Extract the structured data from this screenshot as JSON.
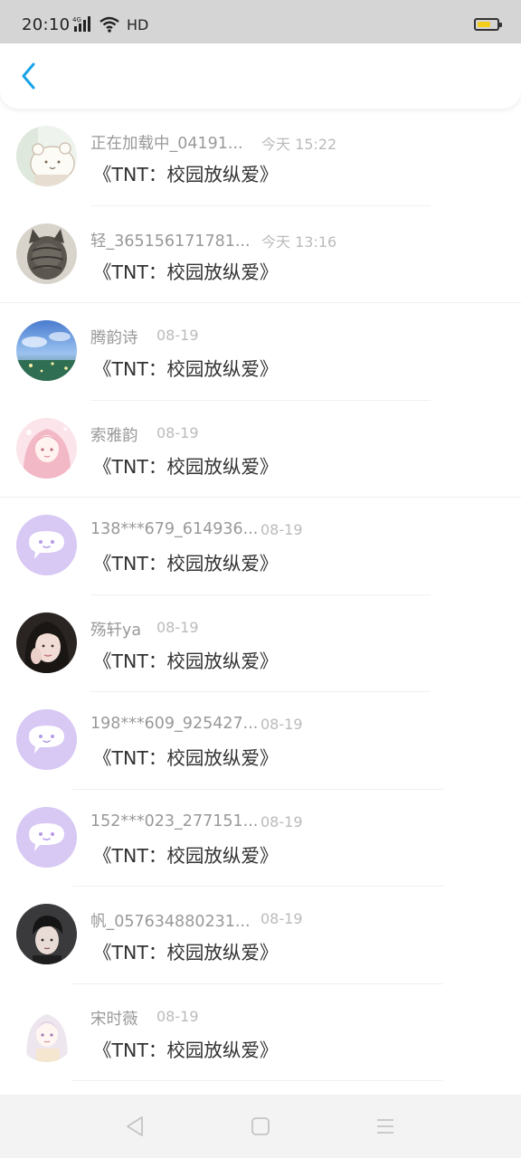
{
  "status_bar": {
    "time": "20:10",
    "network": "4G",
    "hd_label": "HD",
    "battery_level": 0.7
  },
  "header": {
    "back_icon": "chevron-left-icon",
    "accent_color": "#1aa3e8"
  },
  "items": [
    {
      "name": "正在加载中_04191...",
      "time": "今天 15:22",
      "title": "《TNT：校园放纵爱》",
      "avatar": "avatar-cartoon-bear"
    },
    {
      "name": "轻_365156171781...",
      "time": "今天 13:16",
      "title": "《TNT：校园放纵爱》",
      "avatar": "avatar-cat-photo"
    },
    {
      "name": "腾韵诗",
      "time": "08-19",
      "title": "《TNT：校园放纵爱》",
      "avatar": "avatar-anime-scenery"
    },
    {
      "name": "索雅韵",
      "time": "08-19",
      "title": "《TNT：校园放纵爱》",
      "avatar": "avatar-anime-girl-pink"
    },
    {
      "name": "138***679_614936...",
      "time": "08-19",
      "title": "《TNT：校园放纵爱》",
      "avatar": "avatar-default-chat"
    },
    {
      "name": "殇轩ya",
      "time": "08-19",
      "title": "《TNT：校园放纵爱》",
      "avatar": "avatar-girl-photo"
    },
    {
      "name": "198***609_925427...",
      "time": "08-19",
      "title": "《TNT：校园放纵爱》",
      "avatar": "avatar-default-chat"
    },
    {
      "name": "152***023_277151...",
      "time": "08-19",
      "title": "《TNT：校园放纵爱》",
      "avatar": "avatar-default-chat"
    },
    {
      "name": "帆_057634880231...",
      "time": "08-19",
      "title": "《TNT：校园放纵爱》",
      "avatar": "avatar-boy-photo"
    },
    {
      "name": "宋时薇",
      "time": "08-19",
      "title": "《TNT：校园放纵爱》",
      "avatar": "avatar-anime-girl-white"
    }
  ],
  "nav": {
    "back": "triangle-back-icon",
    "home": "square-home-icon",
    "menu": "menu-lines-icon"
  }
}
